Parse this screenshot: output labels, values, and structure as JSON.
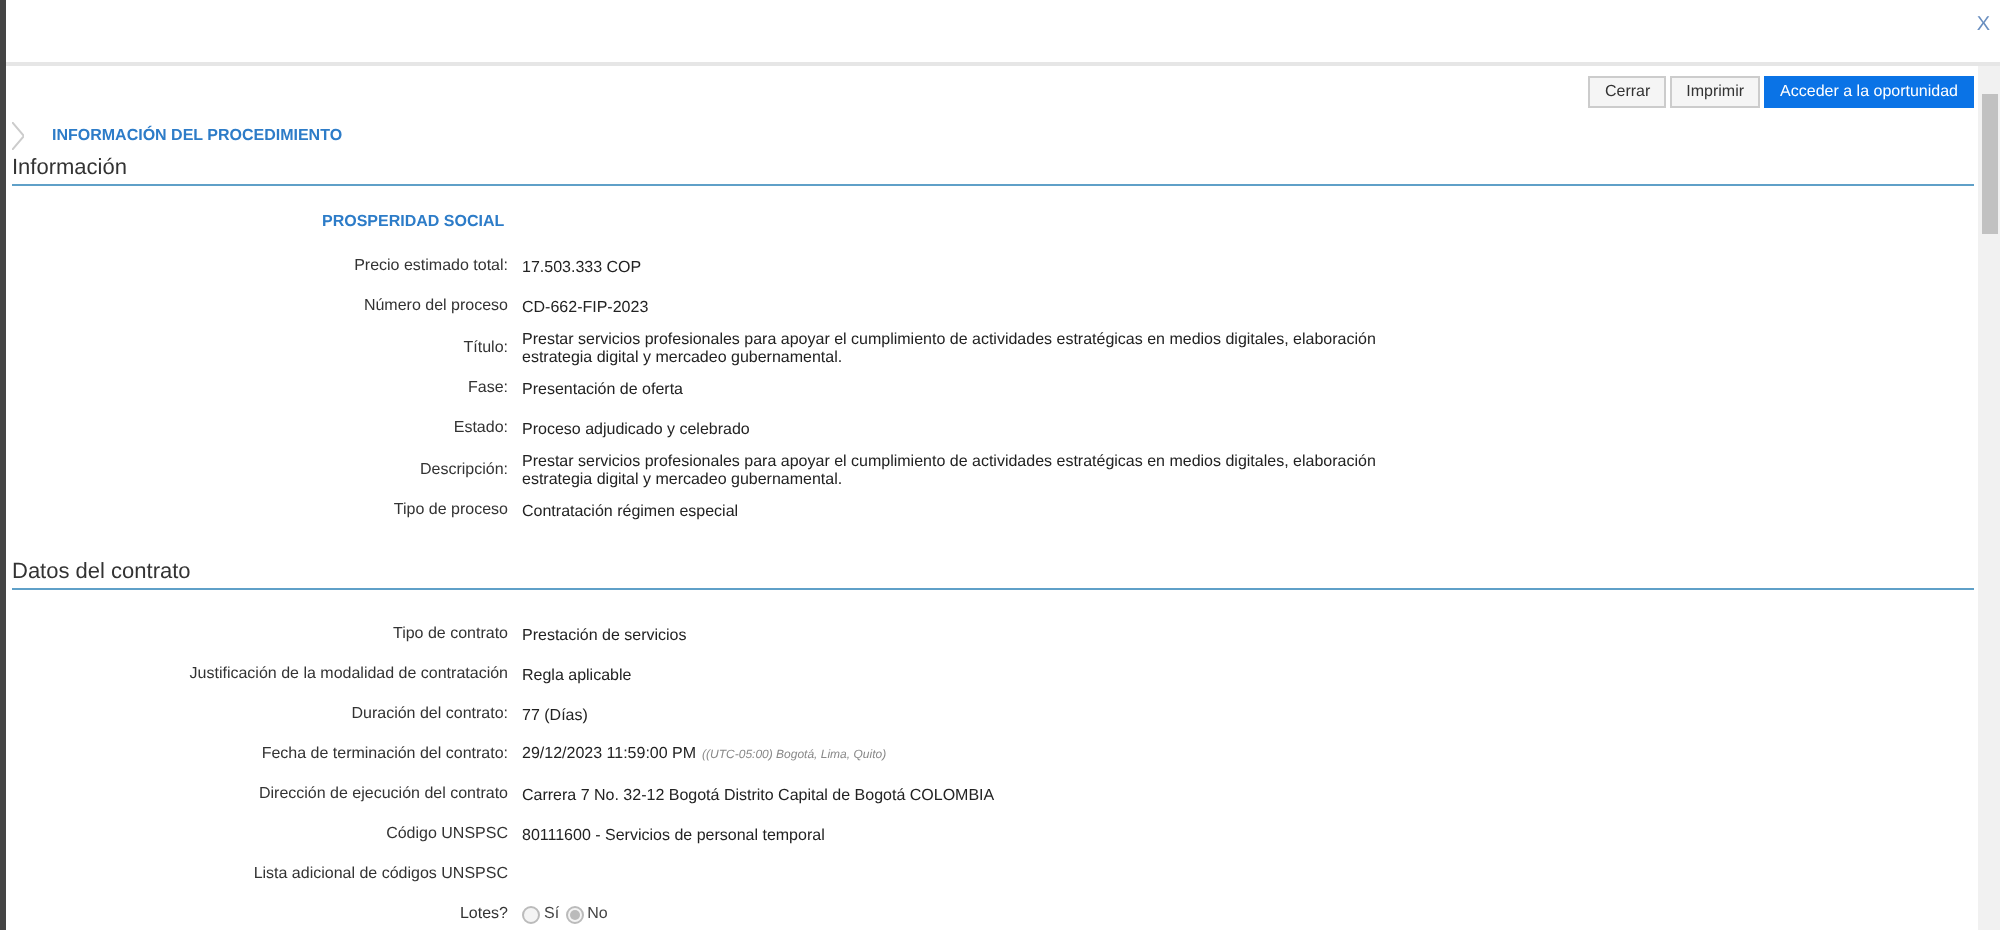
{
  "close_label": "X",
  "buttons": [
    {
      "label": "Cerrar",
      "primary": false
    },
    {
      "label": "Imprimir",
      "primary": false
    },
    {
      "label": "Acceder a la oportunidad",
      "primary": true
    }
  ],
  "procedure_title": "INFORMACIÓN DEL PROCEDIMIENTO",
  "sections": [
    {
      "title": "Información",
      "entity": "PROSPERIDAD SOCIAL",
      "fields": [
        {
          "label": "Precio estimado total:",
          "value": "17.503.333 COP"
        },
        {
          "label": "Número del proceso",
          "value": "CD-662-FIP-2023"
        },
        {
          "label": "Título:",
          "value": "Prestar servicios profesionales para apoyar el cumplimiento de actividades estratégicas en medios digitales, elaboración estrategia digital y mercadeo gubernamental."
        },
        {
          "label": "Fase:",
          "value": "Presentación de oferta"
        },
        {
          "label": "Estado:",
          "value": "Proceso adjudicado y celebrado"
        },
        {
          "label": "Descripción:",
          "value": "Prestar servicios profesionales para apoyar el cumplimiento de actividades estratégicas en medios digitales, elaboración estrategia digital y mercadeo gubernamental."
        },
        {
          "label": "Tipo de proceso",
          "value": "Contratación régimen especial"
        }
      ]
    },
    {
      "title": "Datos del contrato",
      "fields": [
        {
          "label": "Tipo de contrato",
          "value": "Prestación de servicios"
        },
        {
          "label": "Justificación de la modalidad de contratación",
          "value": "Regla aplicable"
        },
        {
          "label": "Duración del contrato:",
          "value": "77 (Días)"
        },
        {
          "label": "Fecha de terminación del contrato:",
          "value": "29/12/2023 11:59:00 PM",
          "note": "((UTC-05:00) Bogotá, Lima, Quito)"
        },
        {
          "label": "Dirección de ejecución del contrato",
          "value": "Carrera 7 No. 32-12 Bogotá Distrito Capital de Bogotá COLOMBIA"
        },
        {
          "label": "Código UNSPSC",
          "value": "80111600 - Servicios de personal temporal"
        },
        {
          "label": "Lista adicional de códigos UNSPSC"
        },
        {
          "label": "Lotes?",
          "options": [
            {
              "label": "Sí",
              "selected": false
            },
            {
              "label": "No",
              "selected": true
            }
          ]
        }
      ]
    }
  ]
}
